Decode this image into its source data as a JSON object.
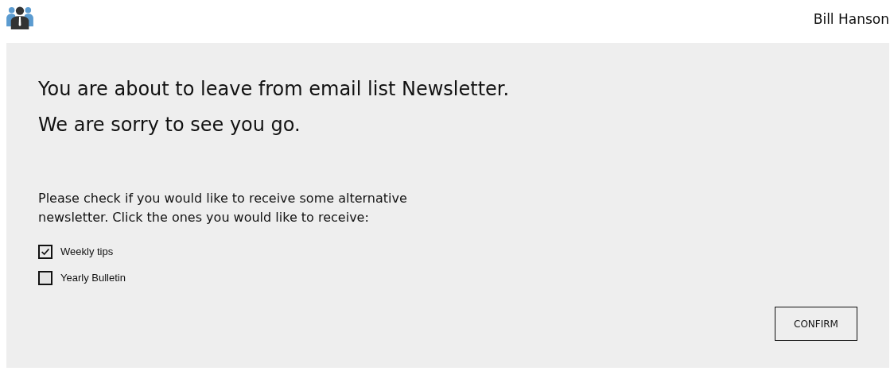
{
  "header": {
    "user_name": "Bill Hanson"
  },
  "message": {
    "lines": [
      "You are about to leave from email list Newsletter.",
      "We are sorry to see you go."
    ]
  },
  "prompt": "Please check if you would like to receive some alternative newsletter. Click the ones you would like to receive:",
  "options": [
    {
      "label": "Weekly tips",
      "checked": true
    },
    {
      "label": "Yearly Bulletin",
      "checked": false
    }
  ],
  "confirm_button": "CONFIRM"
}
